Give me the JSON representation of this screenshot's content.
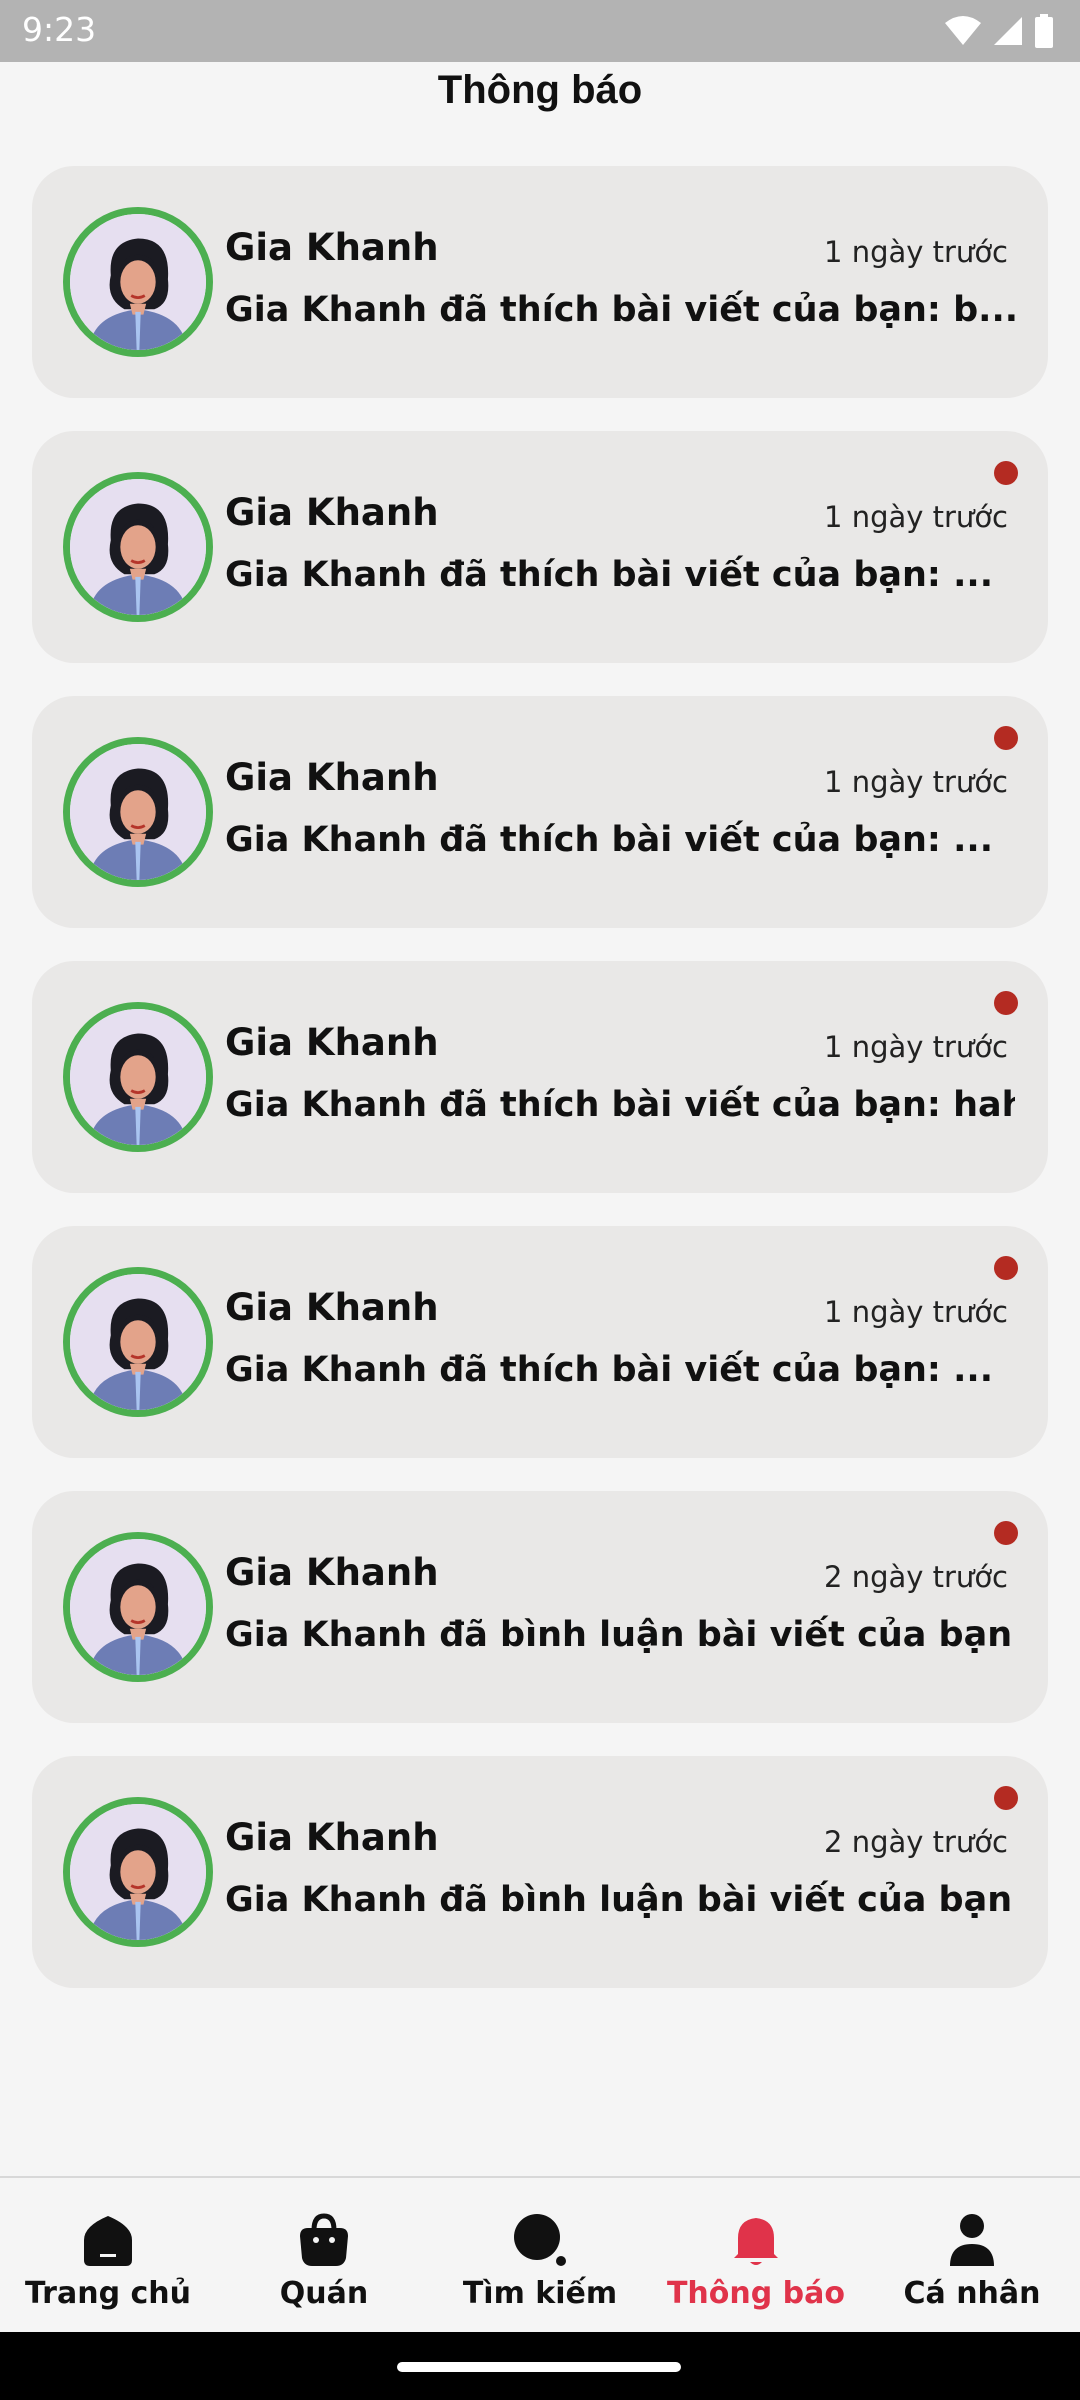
{
  "status_bar": {
    "time": "9:23",
    "icons": [
      "wifi-icon",
      "signal-icon",
      "battery-icon"
    ]
  },
  "header": {
    "title": "Thông báo"
  },
  "notifications": [
    {
      "name": "Gia Khanh",
      "time": "1 ngày trước",
      "message": "Gia Khanh đã thích bài viết của bạn: b...",
      "unread": false
    },
    {
      "name": "Gia Khanh",
      "time": "1 ngày trước",
      "message": "Gia Khanh đã thích bài viết của bạn: ...",
      "unread": true
    },
    {
      "name": "Gia Khanh",
      "time": "1 ngày trước",
      "message": "Gia Khanh đã thích bài viết của bạn: ...",
      "unread": true
    },
    {
      "name": "Gia Khanh",
      "time": "1 ngày trước",
      "message": "Gia Khanh đã thích bài viết của bạn: haha...",
      "unread": true
    },
    {
      "name": "Gia Khanh",
      "time": "1 ngày trước",
      "message": "Gia Khanh đã thích bài viết của bạn: ...",
      "unread": true
    },
    {
      "name": "Gia Khanh",
      "time": "2 ngày trước",
      "message": "Gia Khanh đã bình luận bài viết của bạn: ...",
      "unread": true
    },
    {
      "name": "Gia Khanh",
      "time": "2 ngày trước",
      "message": "Gia Khanh đã bình luận bài viết của bạn: ...",
      "unread": true
    }
  ],
  "bottom_nav": {
    "items": [
      {
        "label": "Trang chủ",
        "icon": "home-icon",
        "active": false
      },
      {
        "label": "Quán",
        "icon": "shopping-bag-icon",
        "active": false
      },
      {
        "label": "Tìm kiếm",
        "icon": "search-icon",
        "active": false
      },
      {
        "label": "Thông báo",
        "icon": "bell-icon",
        "active": true
      },
      {
        "label": "Cá nhân",
        "icon": "person-icon",
        "active": false
      }
    ]
  },
  "colors": {
    "accent": "#e0334a",
    "avatar_ring": "#4caf50",
    "unread_dot": "#b42b22",
    "card_bg": "#e9e8e7"
  }
}
